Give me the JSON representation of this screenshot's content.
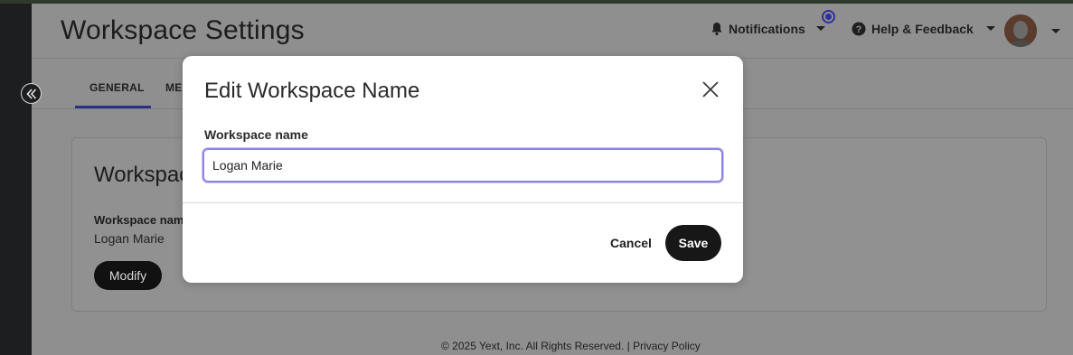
{
  "header": {
    "title": "Workspace Settings",
    "notifications_label": "Notifications",
    "help_label": "Help & Feedback"
  },
  "tabs": [
    {
      "label": "GENERAL",
      "active": true
    },
    {
      "label": "ME"
    }
  ],
  "card": {
    "title": "Workspac",
    "field_label": "Workspace nam",
    "field_value": "Logan Marie",
    "modify_label": "Modify"
  },
  "footer": {
    "text": "© 2025 Yext, Inc. All Rights Reserved. |",
    "privacy_label": "Privacy Policy"
  },
  "modal": {
    "title": "Edit Workspace Name",
    "field_label": "Workspace name",
    "field_value": "Logan Marie",
    "cancel_label": "Cancel",
    "save_label": "Save"
  },
  "colors": {
    "accent": "#2e2f9c",
    "focus_ring": "#8b85e6",
    "sidebar": "#1d1e1f",
    "primary_button": "#171717"
  },
  "icons": {
    "collapse": "double-chevron-left-icon",
    "bell": "bell-icon",
    "help": "question-circle-icon",
    "caret": "caret-down-icon",
    "close": "close-icon"
  }
}
